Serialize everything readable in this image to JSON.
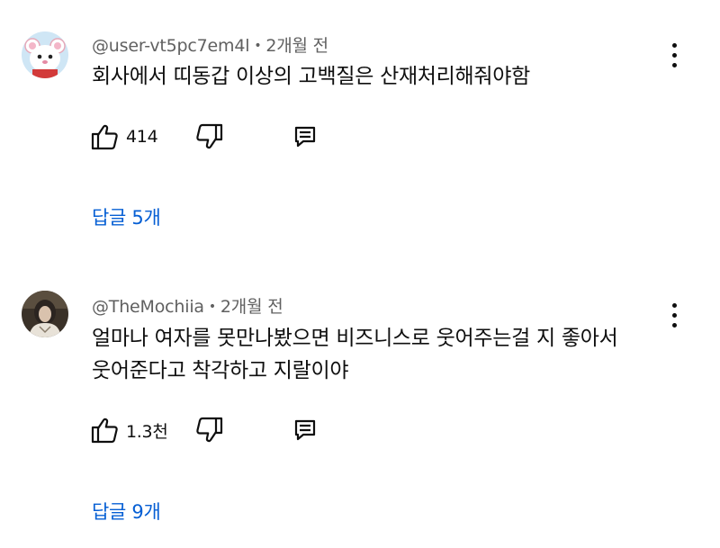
{
  "comments": [
    {
      "author": "@user-vt5pc7em4l",
      "time": "2개월 전",
      "lines": [
        "회사에서 띠동갑 이상의 고백질은 산재처리해줘야함"
      ],
      "likes": "414",
      "replies_label": "답글 5개",
      "avatar": "white-mouse-avatar"
    },
    {
      "author": "@TheMochiia",
      "time": "2개월 전",
      "lines": [
        "얼마나 여자를 못만나봤으면 비즈니스로 웃어주는걸 지 좋아서",
        "웃어준다고 착각하고 지랄이야"
      ],
      "likes": "1.3천",
      "replies_label": "답글 9개",
      "avatar": "portrait-photo-avatar"
    }
  ],
  "separator": "•",
  "colors": {
    "link": "#065fd4",
    "meta": "#606060",
    "text": "#0f0f0f"
  }
}
